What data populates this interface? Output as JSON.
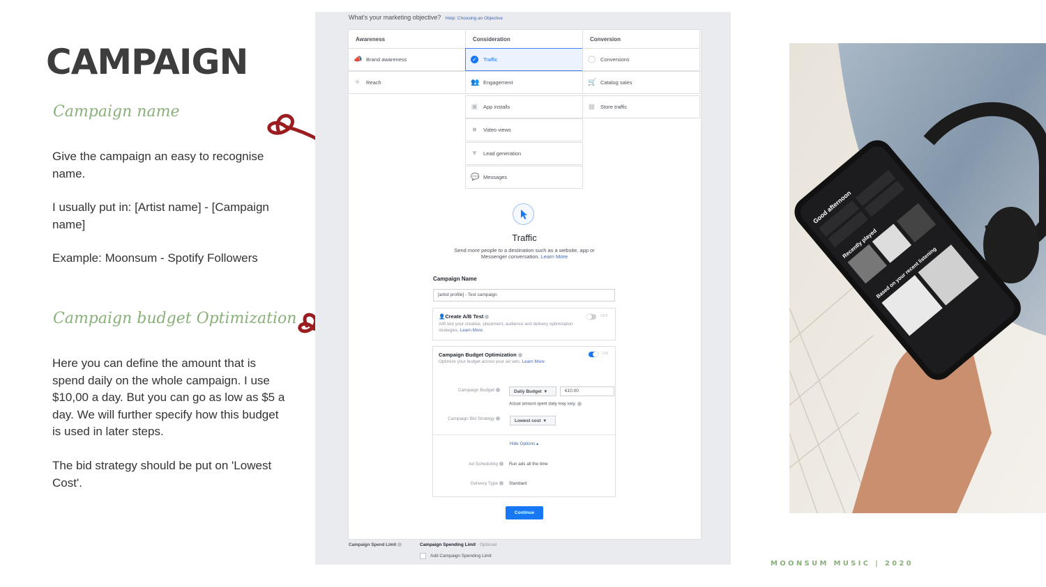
{
  "slide": {
    "title": "CAMPAIGN",
    "section1": {
      "heading": "Campaign name",
      "p1": "Give the campaign an easy to recognise name.",
      "p2": "I usually put in: [Artist name] - [Campaign name]",
      "p3": "Example: Moonsum - Spotify Followers"
    },
    "section2": {
      "heading": "Campaign budget Optimization",
      "p1": "Here you can define the amount that is spend daily on the whole campaign.  I use $10,00 a day. But you can go as low as $5 a day. We will further specify how this budget is used in later steps.",
      "p2": "The bid strategy should be put on 'Lowest Cost'."
    },
    "footer": "MOONSUM MUSIC | 2020",
    "colors": {
      "accent": "#8ab07a",
      "arrow": "#9b1d20",
      "fb_blue": "#1877f2"
    }
  },
  "fb": {
    "question": "What's your marketing objective?",
    "help_link": "Help: Choosing an Objective",
    "columns": [
      "Awareness",
      "Consideration",
      "Conversion"
    ],
    "awareness": [
      {
        "label": "Brand awareness",
        "icon": "megaphone-icon"
      },
      {
        "label": "Reach",
        "icon": "snowflake-icon"
      }
    ],
    "consideration": [
      {
        "label": "Traffic",
        "icon": "check-circle-icon"
      },
      {
        "label": "Engagement",
        "icon": "people-icon"
      },
      {
        "label": "App installs",
        "icon": "box-icon"
      },
      {
        "label": "Video views",
        "icon": "video-camera-icon"
      },
      {
        "label": "Lead generation",
        "icon": "funnel-icon"
      },
      {
        "label": "Messages",
        "icon": "chat-bubble-icon"
      }
    ],
    "conversion": [
      {
        "label": "Conversions",
        "icon": "globe-icon"
      },
      {
        "label": "Catalog sales",
        "icon": "cart-icon"
      },
      {
        "label": "Store traffic",
        "icon": "store-icon"
      }
    ],
    "selected_objective": {
      "title": "Traffic",
      "desc": "Send more people to a destination such as a website, app or Messenger conversation.",
      "learn_more": "Learn More"
    },
    "campaign_name": {
      "label": "Campaign Name",
      "value": "[artist profile] - Test campaign"
    },
    "ab_test": {
      "title": "Create A/B Test",
      "desc": "A/B test your creative, placement, audience and delivery optimization strategies.",
      "learn_more": "Learn More",
      "state": "OFF"
    },
    "cbo": {
      "title": "Campaign Budget Optimization",
      "desc": "Optimize your budget across your ad sets.",
      "learn_more": "Learn More",
      "state": "ON",
      "budget_label": "Campaign Budget",
      "budget_type": "Daily Budget",
      "budget_value": "€10.00",
      "budget_note": "Actual amount spent daily may vary.",
      "bid_label": "Campaign Bid Strategy",
      "bid_value": "Lowest cost",
      "hide_options": "Hide Options ▴",
      "sched_label": "Ad Scheduling",
      "sched_value": "Run ads all the time",
      "delivery_label": "Delivery Type",
      "delivery_value": "Standard"
    },
    "continue_button": "Continue",
    "spend_limit_label": "Campaign Spend Limit",
    "spend_limit_title": "Campaign Spending Limit",
    "spend_limit_optional": " · Optional",
    "spend_limit_checkbox": "Add Campaign Spending Limit"
  },
  "photo": {
    "phone_texts": [
      "Good afternoon",
      "Recently played",
      "Based on your recent listening"
    ]
  }
}
